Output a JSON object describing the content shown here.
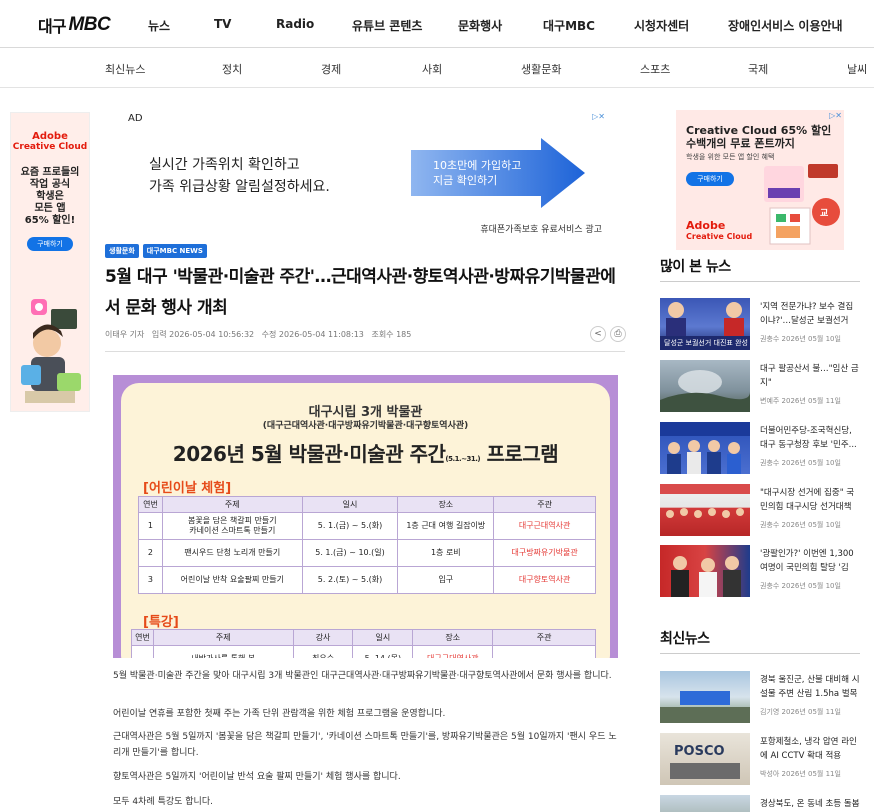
{
  "header": {
    "logo_ko": "대구",
    "logo_en": "MBC",
    "menu": [
      "뉴스",
      "TV",
      "Radio",
      "유튜브 콘텐츠",
      "문화행사",
      "대구MBC",
      "시청자센터",
      "장애인서비스 이용안내"
    ]
  },
  "subnav": [
    "최신뉴스",
    "정치",
    "경제",
    "사회",
    "생활문화",
    "스포츠",
    "국제",
    "날씨"
  ],
  "ad_left": {
    "brand_top": "Adobe",
    "brand_bottom": "Creative Cloud",
    "text": [
      "요즘 프로들의",
      "작업 공식",
      "학생은",
      "모든 앱",
      "65% 할인!"
    ],
    "button": "구매하기"
  },
  "ad_top": {
    "label": "AD",
    "line1": "실시간 가족위치 확인하고",
    "line2": "가족 위급상황 알림설정하세요.",
    "arrow_line1": "10초만에 가입하고",
    "arrow_line2": "지금 확인하기",
    "footer": "휴대폰가족보호 유료서비스 광고"
  },
  "article": {
    "tags": [
      "생활문화",
      "대구MBC NEWS"
    ],
    "headline": "5월 대구 '박물관·미술관 주간'…근대역사관·향토역사관·방짜유기박물관에서 문화 행사 개최",
    "meta": {
      "reporter": "이태우 기자",
      "posted": "입력 2026-05-04 10:56:32",
      "updated": "수정 2026-05-04 11:08:13",
      "views": "조회수 185"
    },
    "poster": {
      "line1": "대구시립 3개 박물관",
      "line2": "(대구근대역사관·대구방짜유기박물관·대구향토역사관)",
      "title": "2026년 5월 박물관·미술관 주간",
      "title_period": "(5.1.~31.)",
      "title_suffix": "프로그램",
      "section1": "[어린이날 체험]",
      "table1_headers": [
        "연번",
        "주제",
        "일시",
        "장소",
        "주관"
      ],
      "table1_rows": [
        {
          "no": "1",
          "topic": "봄꽃을 담은 책갈피 만들기",
          "topic2": "카네이션 스마트톡 만들기",
          "date": "5. 1.(금) ~ 5.(화)",
          "place": "1층 근대 여행 길잡이방",
          "org": "대구근대역사관"
        },
        {
          "no": "2",
          "topic": "팬시우드 단청 노리개 만들기",
          "topic2": "",
          "date": "5. 1.(금) ~ 10.(일)",
          "place": "1층 로비",
          "org": "대구방짜유기박물관"
        },
        {
          "no": "3",
          "topic": "어린이날 반착 요술팔찌 만들기",
          "topic2": "",
          "date": "5. 2.(토) ~ 5.(화)",
          "place": "입구",
          "org": "대구향토역사관"
        }
      ],
      "section2": "[특강]",
      "table2_headers": [
        "연번",
        "주제",
        "강사",
        "일시",
        "장소",
        "주관"
      ],
      "table2_row": {
        "topic": "내방가사를 통해 본",
        "speaker": "최우수",
        "date": "5. 14.(목)",
        "place": "대구근대역사관",
        "org": ""
      }
    },
    "paragraphs": [
      "5월 박물관·미술관 주간을 맞아 대구시립 3개 박물관인 대구근대역사관·대구방짜유기박물관·대구향토역사관에서 문화 행사를 합니다.",
      "어린이날 연휴를 포함한 첫째 주는 가족 단위 관람객을 위한 체험 프로그램을 운영합니다.",
      "근대역사관은 5월 5일까지 '봄꽃을 담은 책갈피 만들기', '카네이션 스마트톡 만들기'를, 방짜유기박물관은 5월 10일까지 '팬시 우드 노리개 만들기'를 합니다.",
      "향토역사관은 5일까지 '어린이날 반석 요술 팔찌 만들기' 체험 행사를 합니다.",
      "모두 4차례 특강도 합니다."
    ]
  },
  "ad_right": {
    "headline1": "Creative Cloud 65% 할인",
    "headline2": "수백개의 무료 폰트까지",
    "sub": "학생을 위한 모든 앱 할인 혜택",
    "button": "구매하기",
    "brand_top": "Adobe",
    "brand_bottom": "Creative Cloud"
  },
  "sidebar": {
    "popular_title": "많이 본 뉴스",
    "popular": [
      {
        "title": "'지역 전문가냐? 보수 결집이냐?'…달성군 보궐선거 대...",
        "date": "권충수 2026년 05월 10일",
        "thumb_caption": "달성군 보궐선거 대진표 완성"
      },
      {
        "title": "대구 팔공산서 불…\"임산 금지\"",
        "date": "변예주 2026년 05월 11일",
        "thumb_caption": ""
      },
      {
        "title": "더불어민주당-조국혁신당, 대구 동구청장 후보 '민주...",
        "date": "권충수 2026년 05월 10일",
        "thumb_caption": ""
      },
      {
        "title": "\"대구시장 선거에 집중\" 국민의힘 대구시당 선거대책위...",
        "date": "권충수 2026년 05월 10일",
        "thumb_caption": ""
      },
      {
        "title": "'광팔인가?' 이번엔 1,300여명이 국민의힘 탈당 '김부...",
        "date": "권충수 2026년 05월 10일",
        "thumb_caption": ""
      }
    ],
    "latest_title": "최신뉴스",
    "latest": [
      {
        "title": "경북 울진군, 산불 대비해 시설물 주변 산림 1.5ha 벌목",
        "date": "김기영 2026년 05월 11일"
      },
      {
        "title": "포항제철소, 냉각 압연 라인에 AI CCTV 확대 적용",
        "date": "박성아 2026년 05월 11일"
      },
      {
        "title": "경상북도, 온 동네 초등 돌봄",
        "date": ""
      }
    ]
  },
  "colors": {
    "accent_blue": "#1e6fd9",
    "poster_purple": "#b78ed6",
    "poster_bg": "#fdf3d8",
    "org_red": "#e53935",
    "adobe_red": "#e31b0d"
  }
}
